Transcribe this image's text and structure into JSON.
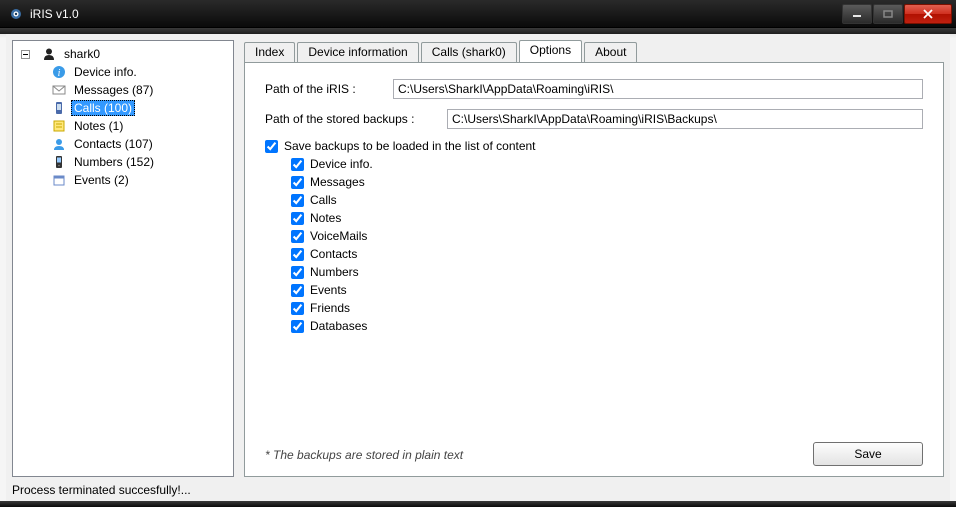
{
  "window": {
    "title": "iRIS v1.0"
  },
  "tree": {
    "root": {
      "label": "shark0",
      "children": [
        {
          "label": "Device info."
        },
        {
          "label": "Messages (87)"
        },
        {
          "label": "Calls (100)",
          "selected": true
        },
        {
          "label": "Notes (1)"
        },
        {
          "label": "Contacts (107)"
        },
        {
          "label": "Numbers (152)"
        },
        {
          "label": "Events (2)"
        }
      ]
    }
  },
  "tabs": [
    {
      "label": "Index"
    },
    {
      "label": "Device information"
    },
    {
      "label": "Calls (shark0)"
    },
    {
      "label": "Options",
      "active": true
    },
    {
      "label": "About"
    }
  ],
  "options": {
    "path_iris_label": "Path of the iRIS :",
    "path_iris_value": "C:\\Users\\SharkI\\AppData\\Roaming\\iRIS\\",
    "path_backups_label": "Path of the stored backups :",
    "path_backups_value": "C:\\Users\\SharkI\\AppData\\Roaming\\iRIS\\Backups\\",
    "save_backups_label": "Save backups to be loaded in the list of content",
    "items": [
      {
        "label": "Device info."
      },
      {
        "label": "Messages"
      },
      {
        "label": "Calls"
      },
      {
        "label": "Notes"
      },
      {
        "label": "VoiceMails"
      },
      {
        "label": "Contacts"
      },
      {
        "label": "Numbers"
      },
      {
        "label": "Events"
      },
      {
        "label": "Friends"
      },
      {
        "label": "Databases"
      }
    ],
    "footnote": "* The backups are stored in plain text",
    "save_button": "Save"
  },
  "status": "Process terminated succesfully!..."
}
